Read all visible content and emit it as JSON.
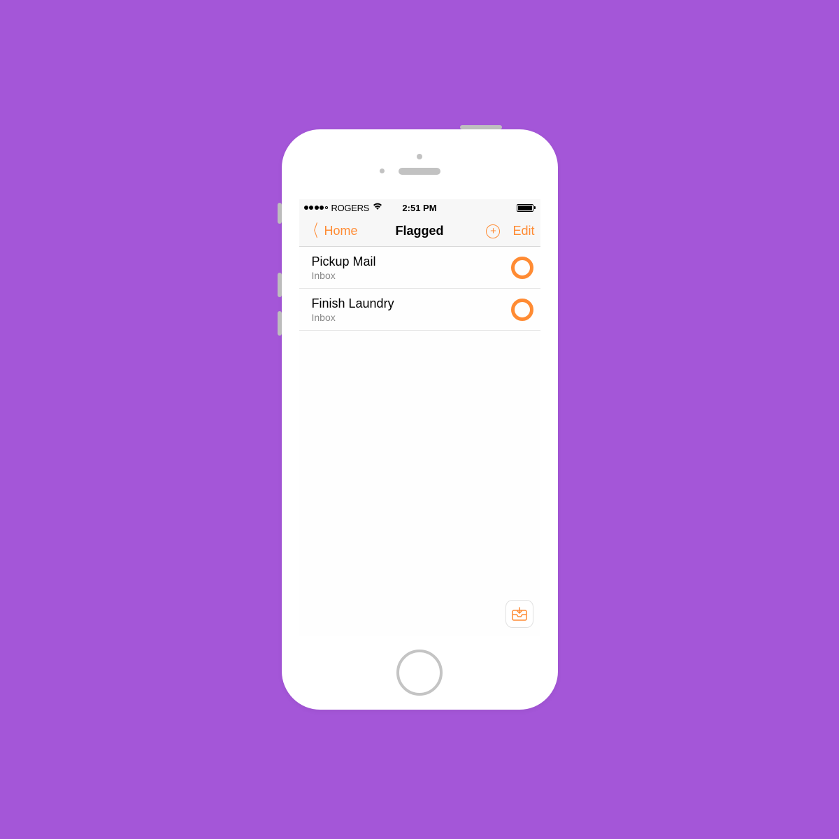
{
  "status": {
    "carrier": "ROGERS",
    "time": "2:51 PM"
  },
  "nav": {
    "back_label": "Home",
    "title": "Flagged",
    "edit_label": "Edit"
  },
  "tasks": [
    {
      "title": "Pickup Mail",
      "list": "Inbox"
    },
    {
      "title": "Finish Laundry",
      "list": "Inbox"
    }
  ],
  "colors": {
    "accent": "#ff8b33",
    "background": "#a456d8"
  }
}
